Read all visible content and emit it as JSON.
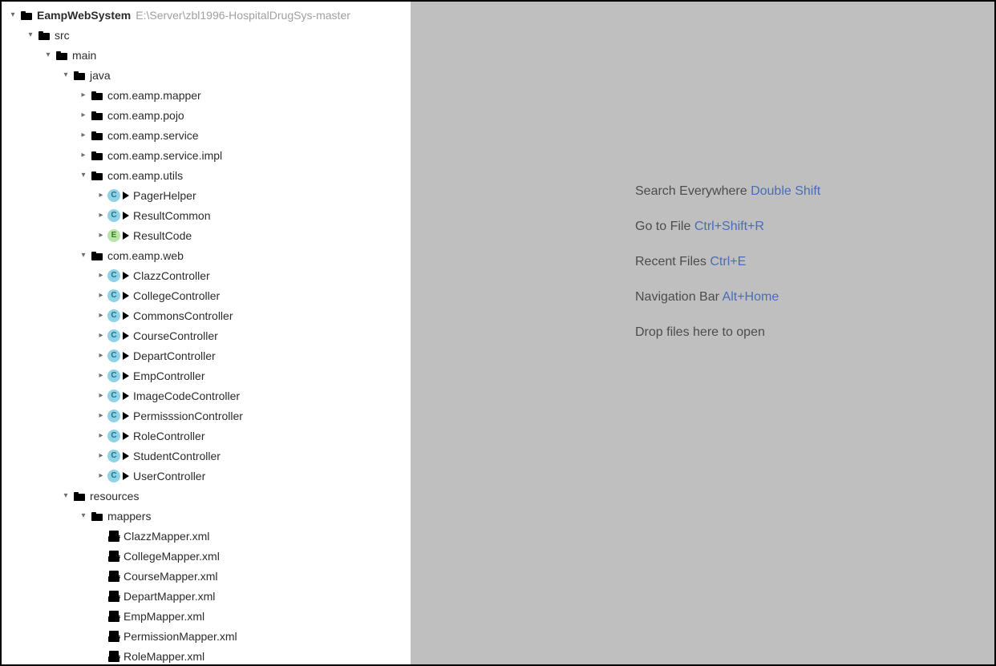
{
  "project": {
    "name": "EampWebSystem",
    "path": "E:\\Server\\zbl1996-HospitalDrugSys-master"
  },
  "hints": [
    {
      "text": "Search Everywhere",
      "shortcut": "Double Shift"
    },
    {
      "text": "Go to File",
      "shortcut": "Ctrl+Shift+R"
    },
    {
      "text": "Recent Files",
      "shortcut": "Ctrl+E"
    },
    {
      "text": "Navigation Bar",
      "shortcut": "Alt+Home"
    },
    {
      "text": "Drop files here to open",
      "shortcut": ""
    }
  ],
  "tree": [
    {
      "depth": 0,
      "arrow": "expanded",
      "icon": "project",
      "label": "EampWebSystem",
      "bold": true,
      "path": "E:\\Server\\zbl1996-HospitalDrugSys-master"
    },
    {
      "depth": 1,
      "arrow": "expanded",
      "icon": "folder",
      "label": "src"
    },
    {
      "depth": 2,
      "arrow": "expanded",
      "icon": "folder",
      "label": "main"
    },
    {
      "depth": 3,
      "arrow": "expanded",
      "icon": "folder-src",
      "label": "java"
    },
    {
      "depth": 4,
      "arrow": "collapsed",
      "icon": "package",
      "label": "com.eamp.mapper"
    },
    {
      "depth": 4,
      "arrow": "collapsed",
      "icon": "package",
      "label": "com.eamp.pojo"
    },
    {
      "depth": 4,
      "arrow": "collapsed",
      "icon": "package",
      "label": "com.eamp.service"
    },
    {
      "depth": 4,
      "arrow": "collapsed",
      "icon": "package",
      "label": "com.eamp.service.impl"
    },
    {
      "depth": 4,
      "arrow": "expanded",
      "icon": "package",
      "label": "com.eamp.utils"
    },
    {
      "depth": 5,
      "arrow": "collapsed",
      "icon": "class",
      "run": true,
      "label": "PagerHelper"
    },
    {
      "depth": 5,
      "arrow": "collapsed",
      "icon": "class",
      "run": true,
      "label": "ResultCommon"
    },
    {
      "depth": 5,
      "arrow": "collapsed",
      "icon": "enum",
      "run": true,
      "label": "ResultCode"
    },
    {
      "depth": 4,
      "arrow": "expanded",
      "icon": "package",
      "label": "com.eamp.web"
    },
    {
      "depth": 5,
      "arrow": "collapsed",
      "icon": "class",
      "run": true,
      "label": "ClazzController"
    },
    {
      "depth": 5,
      "arrow": "collapsed",
      "icon": "class",
      "run": true,
      "label": "CollegeController"
    },
    {
      "depth": 5,
      "arrow": "collapsed",
      "icon": "class",
      "run": true,
      "label": "CommonsController"
    },
    {
      "depth": 5,
      "arrow": "collapsed",
      "icon": "class",
      "run": true,
      "label": "CourseController"
    },
    {
      "depth": 5,
      "arrow": "collapsed",
      "icon": "class",
      "run": true,
      "label": "DepartController"
    },
    {
      "depth": 5,
      "arrow": "collapsed",
      "icon": "class",
      "run": true,
      "label": "EmpController"
    },
    {
      "depth": 5,
      "arrow": "collapsed",
      "icon": "class",
      "run": true,
      "label": "ImageCodeController"
    },
    {
      "depth": 5,
      "arrow": "collapsed",
      "icon": "class",
      "run": true,
      "label": "PermisssionController"
    },
    {
      "depth": 5,
      "arrow": "collapsed",
      "icon": "class",
      "run": true,
      "label": "RoleController"
    },
    {
      "depth": 5,
      "arrow": "collapsed",
      "icon": "class",
      "run": true,
      "label": "StudentController"
    },
    {
      "depth": 5,
      "arrow": "collapsed",
      "icon": "class",
      "run": true,
      "label": "UserController"
    },
    {
      "depth": 3,
      "arrow": "expanded",
      "icon": "folder-res",
      "label": "resources"
    },
    {
      "depth": 4,
      "arrow": "expanded",
      "icon": "folder",
      "label": "mappers"
    },
    {
      "depth": 5,
      "arrow": "none",
      "icon": "xml",
      "label": "ClazzMapper.xml"
    },
    {
      "depth": 5,
      "arrow": "none",
      "icon": "xml",
      "label": "CollegeMapper.xml"
    },
    {
      "depth": 5,
      "arrow": "none",
      "icon": "xml",
      "label": "CourseMapper.xml"
    },
    {
      "depth": 5,
      "arrow": "none",
      "icon": "xml",
      "label": "DepartMapper.xml"
    },
    {
      "depth": 5,
      "arrow": "none",
      "icon": "xml",
      "label": "EmpMapper.xml"
    },
    {
      "depth": 5,
      "arrow": "none",
      "icon": "xml",
      "label": "PermissionMapper.xml"
    },
    {
      "depth": 5,
      "arrow": "none",
      "icon": "xml",
      "label": "RoleMapper.xml"
    }
  ]
}
